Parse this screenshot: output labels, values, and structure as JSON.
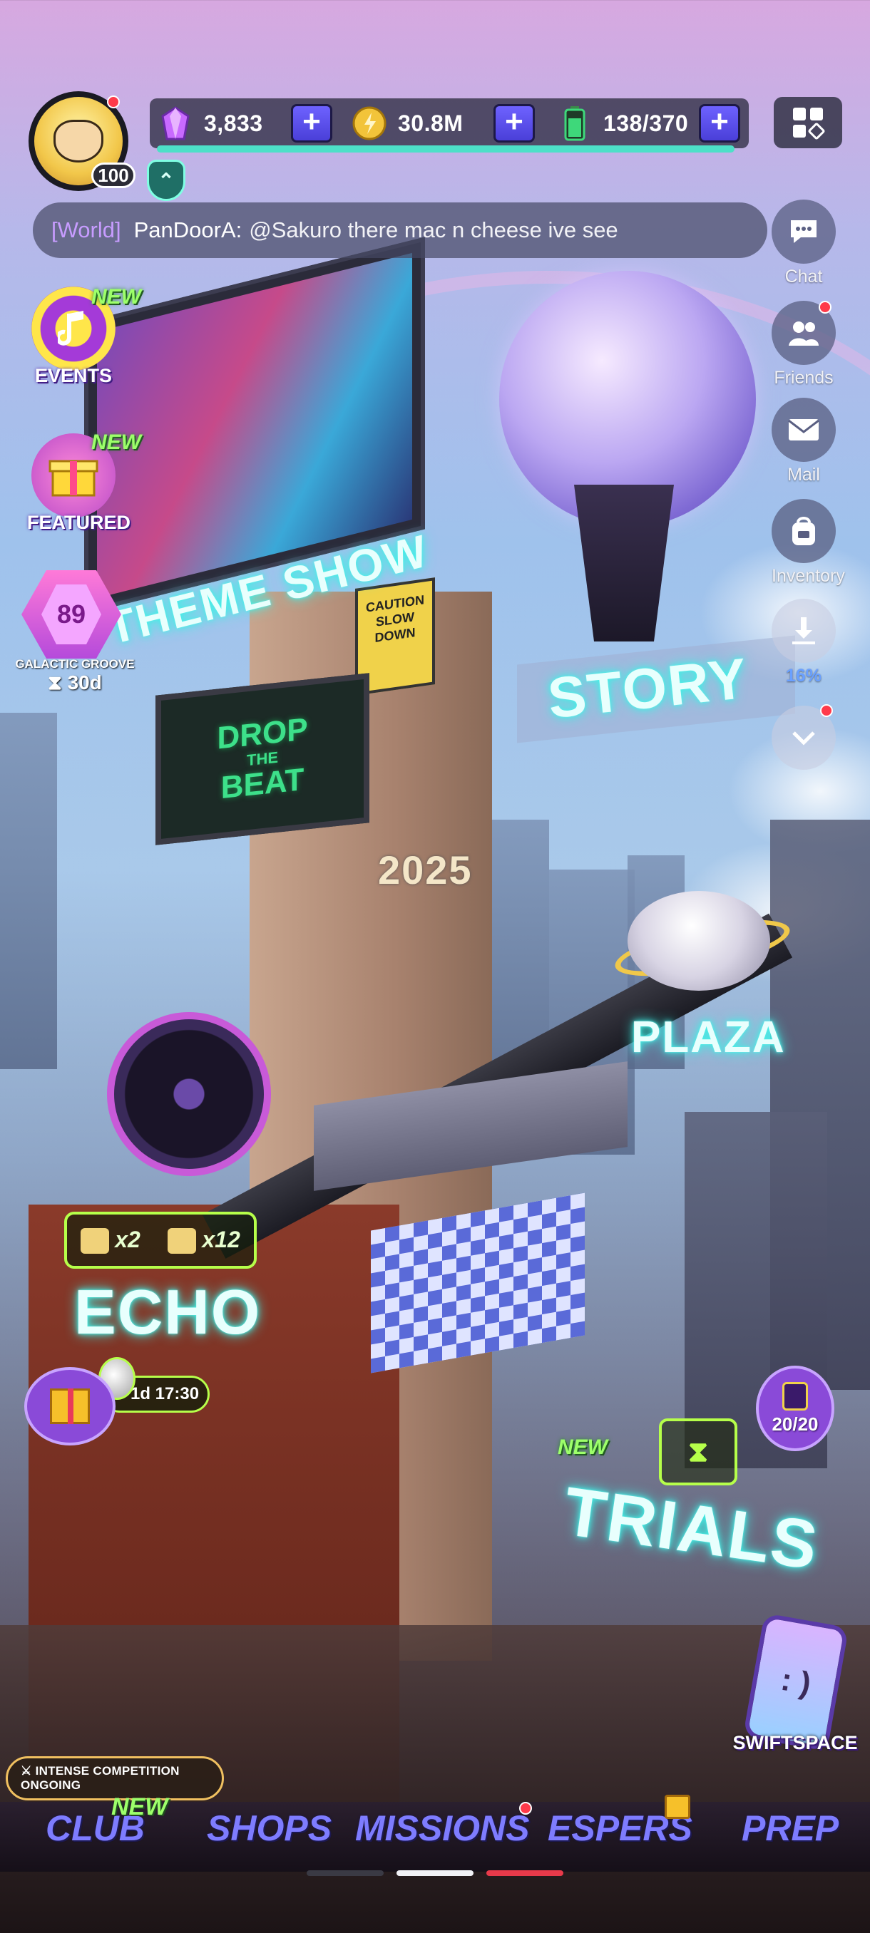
{
  "profile": {
    "level": "100"
  },
  "resources": {
    "gems": "3,833",
    "coins": "30.8M",
    "stamina": "138/370"
  },
  "chat": {
    "channel": "[World]",
    "sender": "PanDoorA:",
    "message": "@Sakuro  there mac n cheese ive see"
  },
  "side_menu": {
    "chat": "Chat",
    "friends": "Friends",
    "mail": "Mail",
    "inventory": "Inventory",
    "download_progress": "16%"
  },
  "left_menu": {
    "events": "EVENTS",
    "featured": "FEATURED",
    "new_tag": "NEW",
    "groove_level": "89",
    "groove_name": "GALACTIC GROOVE",
    "groove_timer": "30d"
  },
  "scene": {
    "show_label": "THEME SHOW",
    "story_label": "STORY",
    "plaza_label": "PLAZA",
    "echo_label": "ECHO",
    "trials_label": "TRIALS",
    "trials_new": "NEW",
    "drop_line1": "DROP",
    "drop_line2": "THE",
    "drop_line3": "BEAT",
    "caution_text": "CAUTION SLOW DOWN",
    "year": "2025",
    "echo_reward_1": "x2",
    "echo_reward_2": "x12",
    "echo_timer": "1d 17:30",
    "stamina_count": "20/20",
    "swiftspace_label": "SWIFTSPACE"
  },
  "bottom_nav": {
    "competition_banner": "⚔ INTENSE COMPETITION ONGOING",
    "club": "CLUB",
    "club_new": "NEW",
    "shops": "SHOPS",
    "missions": "MISSIONS",
    "espers": "ESPERS",
    "prep": "PREP"
  },
  "colors": {
    "accent": "#7e7cff",
    "neon": "#3ff0e6",
    "new_green": "#9dff6a",
    "notification": "#ff3a4a"
  },
  "icons": {
    "gem": "gem-icon",
    "coin": "coin-icon",
    "stamina": "battery-icon",
    "menu": "grid-menu-icon",
    "rank": "rank-chevron-icon"
  }
}
